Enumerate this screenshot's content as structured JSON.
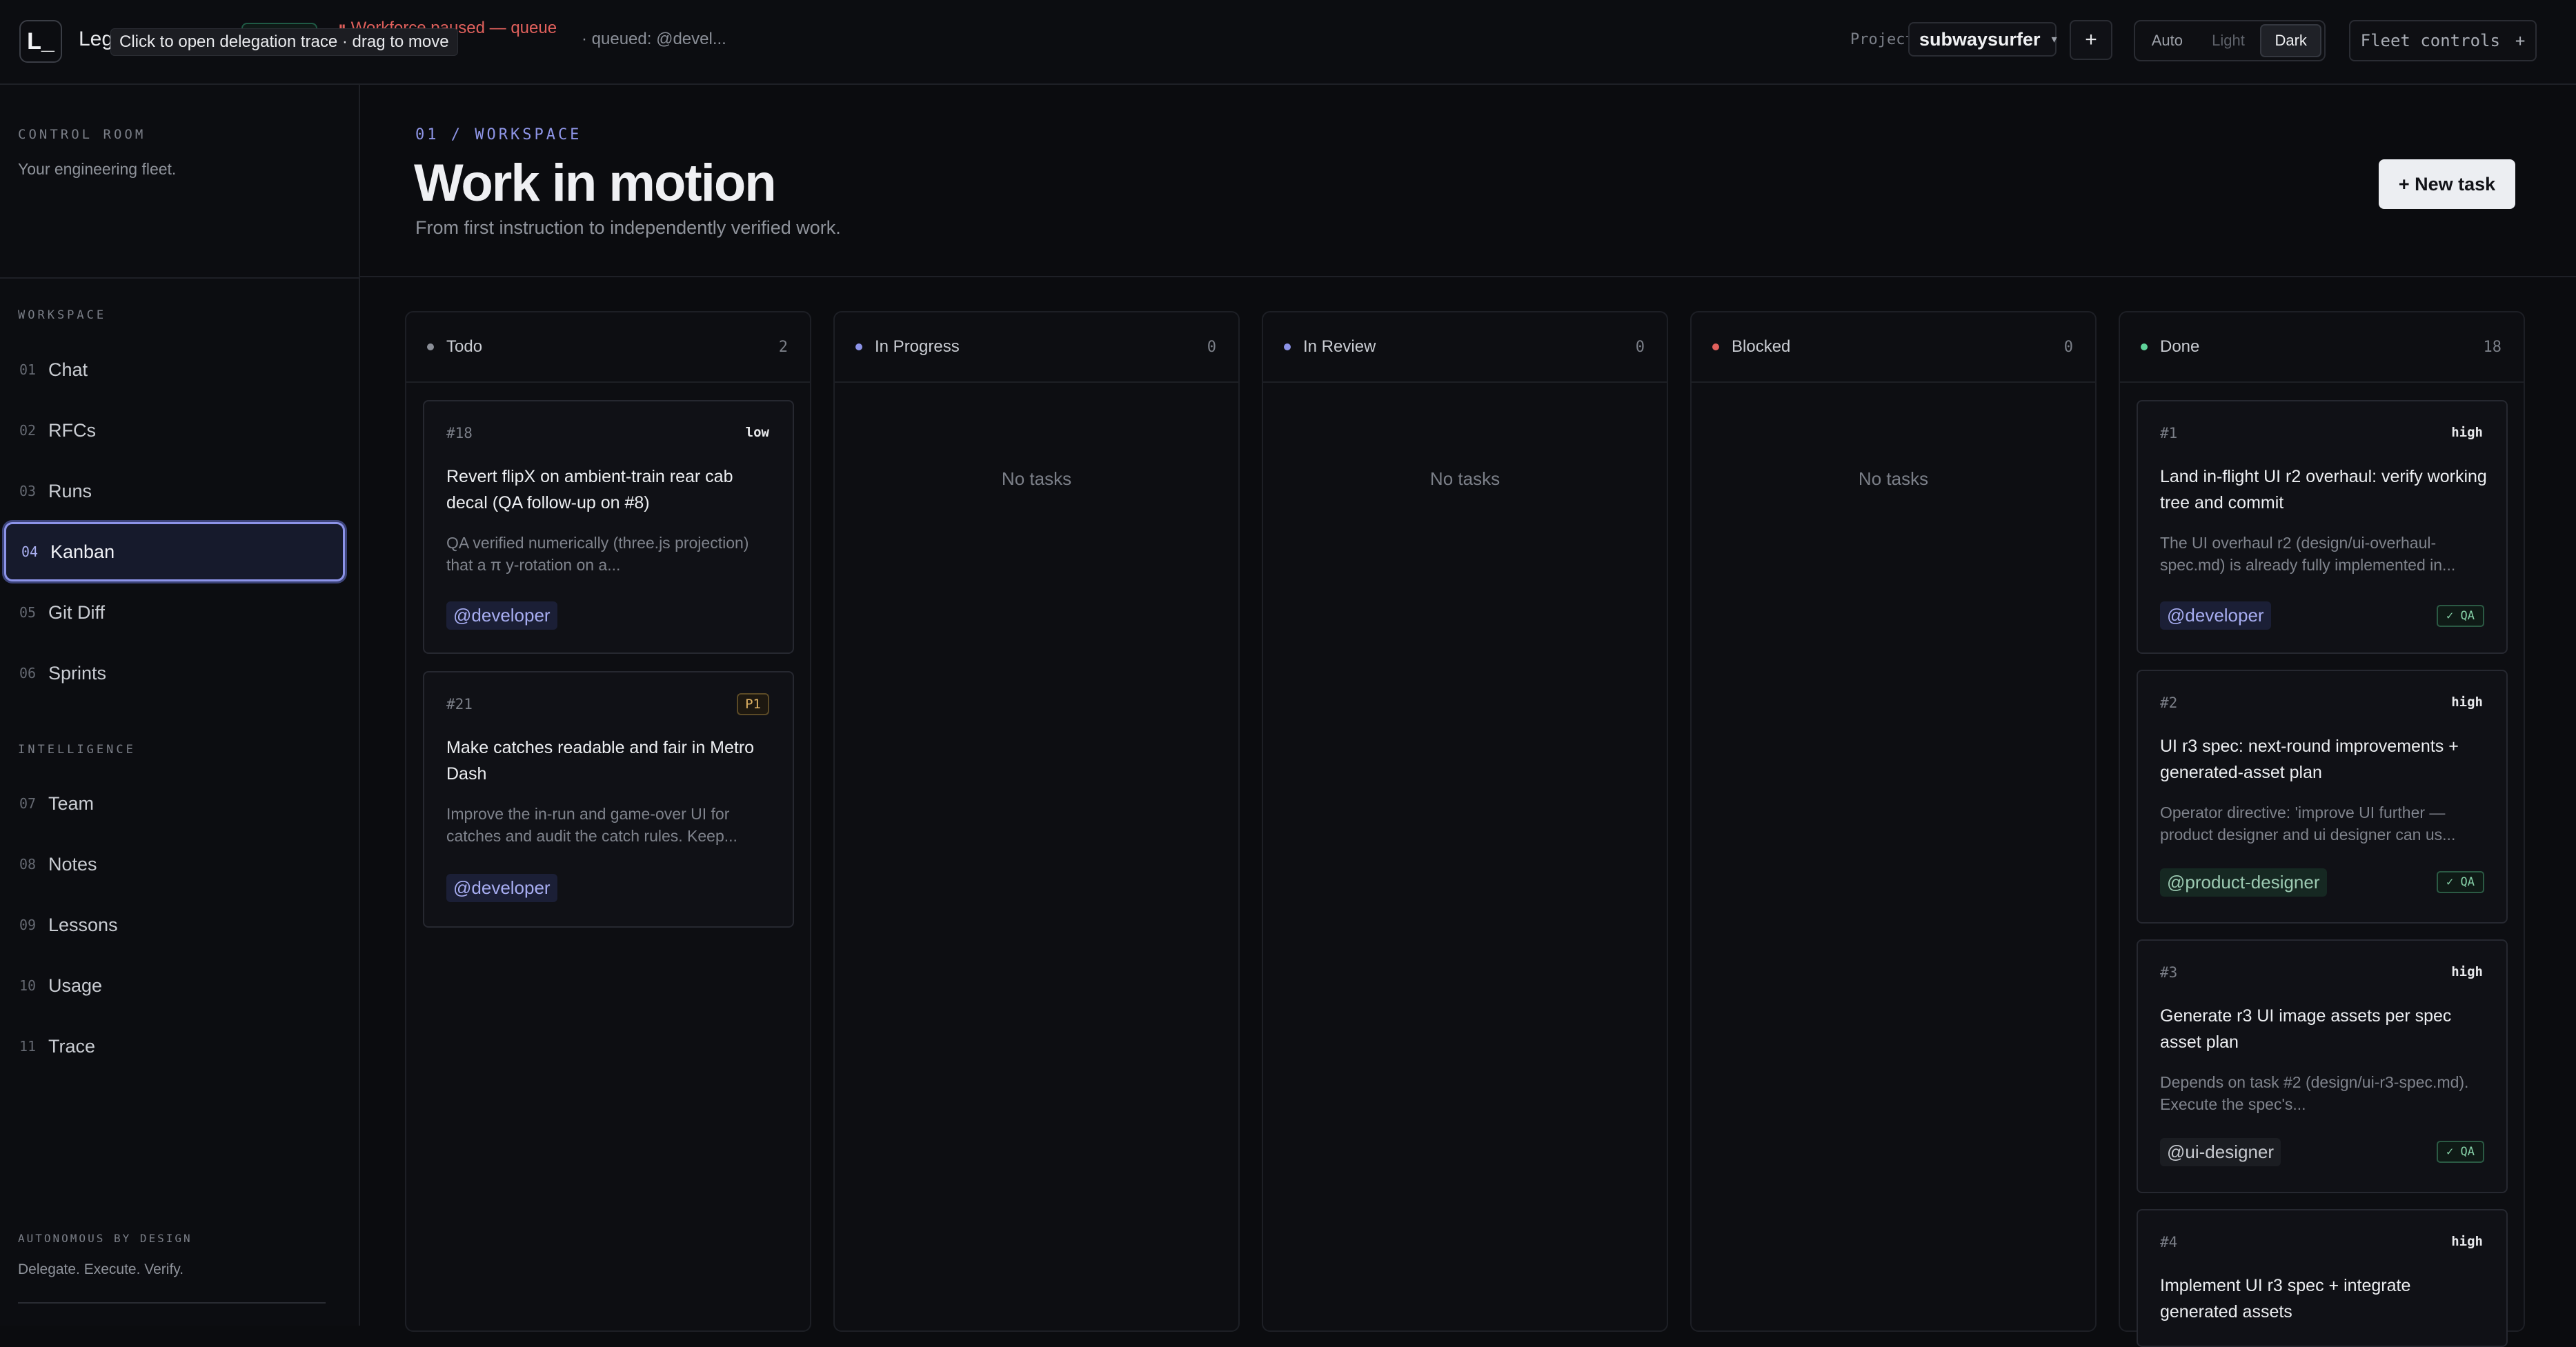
{
  "topbar": {
    "logo": "L_",
    "brand": "Leg",
    "alert": "⏸ Workforce paused — queue",
    "queued": "· queued: @devel...",
    "tooltip": "Click to open delegation trace · drag to move",
    "project_label": "Project",
    "project_value": "subwaysurfer",
    "add_label": "+",
    "theme_options": [
      "Auto",
      "Light",
      "Dark"
    ],
    "theme_selected": "Dark",
    "fleet_label": "Fleet controls",
    "fleet_icon": "+"
  },
  "sidebar": {
    "eyebrow": "CONTROL ROOM",
    "tagline": "Your engineering fleet.",
    "workspace_heading": "WORKSPACE",
    "workspace_items": [
      {
        "num": "01",
        "label": "Chat"
      },
      {
        "num": "02",
        "label": "RFCs"
      },
      {
        "num": "03",
        "label": "Runs"
      },
      {
        "num": "04",
        "label": "Kanban"
      },
      {
        "num": "05",
        "label": "Git Diff"
      },
      {
        "num": "06",
        "label": "Sprints"
      }
    ],
    "active_item": "Kanban",
    "intelligence_heading": "INTELLIGENCE",
    "intelligence_items": [
      {
        "num": "07",
        "label": "Team"
      },
      {
        "num": "08",
        "label": "Notes"
      },
      {
        "num": "09",
        "label": "Lessons"
      },
      {
        "num": "10",
        "label": "Usage"
      },
      {
        "num": "11",
        "label": "Trace"
      }
    ],
    "footer_eyebrow": "AUTONOMOUS BY DESIGN",
    "footer_text": "Delegate. Execute. Verify."
  },
  "header": {
    "crumb": "01 / WORKSPACE",
    "title": "Work in motion",
    "subtitle": "From first instruction to independently verified work.",
    "new_task": "+ New task"
  },
  "colors": {
    "todo": "#8a8e97",
    "in_progress": "#8c93e8",
    "in_review": "#8c93e8",
    "blocked": "#e0605c",
    "done": "#5fd39a",
    "accent": "#8c93e8"
  },
  "board": {
    "empty_text": "No tasks",
    "columns": [
      {
        "name": "Todo",
        "count": "2",
        "cards": [
          {
            "id": "#18",
            "priority": "low",
            "title": "Revert flipX on ambient-train rear cab decal (QA follow-up on #8)",
            "desc": "QA verified numerically (three.js projection) that a π y-rotation on a...",
            "assignee": "@developer"
          },
          {
            "id": "#21",
            "priority": "P1",
            "title": "Make catches readable and fair in Metro Dash",
            "desc": "Improve the in-run and game-over UI for catches and audit the catch rules. Keep...",
            "assignee": "@developer"
          }
        ]
      },
      {
        "name": "In Progress",
        "count": "0",
        "cards": []
      },
      {
        "name": "In Review",
        "count": "0",
        "cards": []
      },
      {
        "name": "Blocked",
        "count": "0",
        "cards": []
      },
      {
        "name": "Done",
        "count": "18",
        "cards": [
          {
            "id": "#1",
            "priority": "high",
            "title": "Land in-flight UI r2 overhaul: verify working tree and commit",
            "desc": "The UI overhaul r2 (design/ui-overhaul-spec.md) is already fully implemented in...",
            "assignee": "@developer",
            "badge": "✓ QA"
          },
          {
            "id": "#2",
            "priority": "high",
            "title": "UI r3 spec: next-round improvements + generated-asset plan",
            "desc": "Operator directive: 'improve UI further — product designer and ui designer can us...",
            "assignee": "@product-designer",
            "badge": "✓ QA"
          },
          {
            "id": "#3",
            "priority": "high",
            "title": "Generate r3 UI image assets per spec asset plan",
            "desc": "Depends on task #2 (design/ui-r3-spec.md). Execute the spec's...",
            "assignee": "@ui-designer",
            "badge": "✓ QA"
          },
          {
            "id": "#4",
            "priority": "high",
            "title": "Implement UI r3 spec + integrate generated assets",
            "desc": "",
            "assignee": ""
          }
        ]
      }
    ]
  }
}
